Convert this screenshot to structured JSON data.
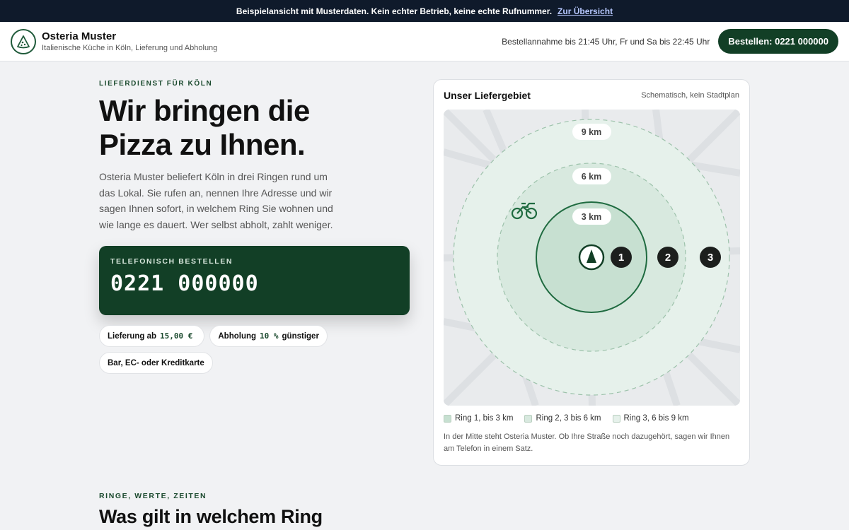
{
  "banner": {
    "text": "Beispielansicht mit Musterdaten. Kein echter Betrieb, keine echte Rufnummer.",
    "link": "Zur Übersicht"
  },
  "header": {
    "brand_name": "Osteria Muster",
    "brand_sub": "Italienische Küche in Köln, Lieferung und Abholung",
    "hours": "Bestellannahme bis 21:45 Uhr, Fr und Sa bis 22:45 Uhr",
    "cta": "Bestellen: 0221 000000"
  },
  "hero": {
    "eyebrow": "LIEFERDIENST FÜR KÖLN",
    "title_line1": "Wir bringen die",
    "title_line2": "Pizza zu Ihnen.",
    "lead": "Osteria Muster beliefert Köln in drei Ringen rund um das Lokal. Sie rufen an, nennen Ihre Adresse und wir sagen Ihnen sofort, in welchem Ring Sie wohnen und wie lange es dauert. Wer selbst abholt, zahlt weniger."
  },
  "phone_card": {
    "label": "TELEFONISCH BESTELLEN",
    "number": "0221 000000"
  },
  "chips": {
    "delivery_prefix": "Lieferung ab",
    "delivery_value": "15,00 €",
    "pickup_prefix": "Abholung",
    "pickup_value": "10 %",
    "pickup_suffix": "günstiger",
    "payment": "Bar, EC- oder Kreditkarte"
  },
  "map": {
    "title": "Unser Liefergebiet",
    "note": "Schematisch, kein Stadtplan",
    "ring_labels": [
      "3 km",
      "6 km",
      "9 km"
    ],
    "ring_numbers": [
      "1",
      "2",
      "3"
    ],
    "legend": [
      "Ring 1, bis 3 km",
      "Ring 2, 3 bis 6 km",
      "Ring 3, 6 bis 9 km"
    ],
    "footnote": "In der Mitte steht Osteria Muster. Ob Ihre Straße noch dazugehört, sagen wir Ihnen am Telefon in einem Satz.",
    "colors": {
      "ring1": "#c7e0d1",
      "ring2": "#d8e9df",
      "ring3": "#e6f1eb",
      "accent": "#1f6b40"
    },
    "icons": [
      "pizza-slice-icon",
      "bicycle-icon"
    ]
  },
  "section2": {
    "eyebrow": "RINGE, WERTE, ZEITEN",
    "title": "Was gilt in welchem Ring"
  }
}
